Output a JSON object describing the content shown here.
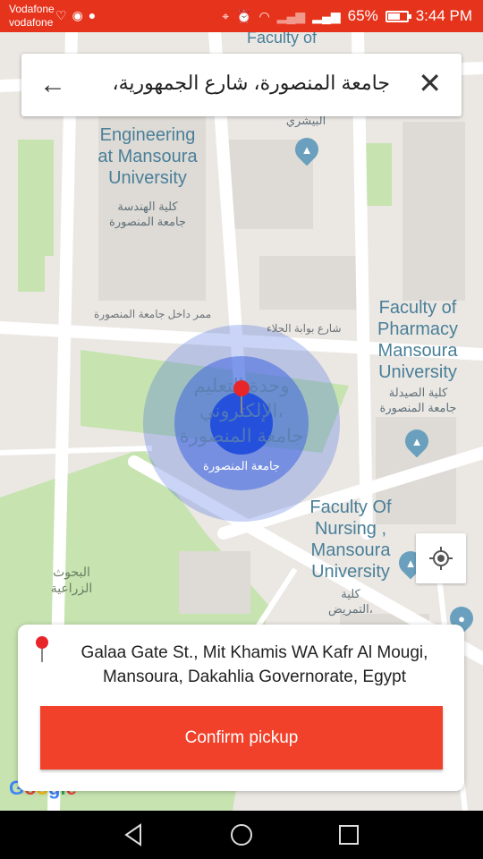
{
  "status_bar": {
    "carrier_1": "Vodafone",
    "carrier_2": "vodafone",
    "battery": "65%",
    "time": "3:44 PM",
    "battery_level": 0.65
  },
  "search": {
    "query": "جامعة المنصورة، شارع الجمهورية،",
    "back_icon": "arrow-left-icon",
    "clear_icon": "close-icon"
  },
  "map": {
    "labels": {
      "faculty_top": "Faculty of",
      "bishri_ar": "البيشري",
      "engineering_en": "Engineering\nat Mansoura\nUniversity",
      "engineering_ar": "كلية الهندسة\nجامعة المنصورة",
      "pharmacy_en": "Faculty of\nPharmacy\nMansoura\nUniversity",
      "pharmacy_ar": "كلية الصيدلة\nجامعة المنصورة",
      "nursing_en": "Faculty Of\nNursing ,\nMansoura\nUniversity",
      "nursing_ar": "كلية\nالتمريض،",
      "research_ar": "البحوث\nالزراعية",
      "road_inner": "ممر داخل جامعة المنصورة",
      "road_gate": "شارع بوابة الجلاء",
      "center_ar": "وحدة التعليم\nالإلكتروني،\nجامعة المنصورة",
      "center_small_ar": "جامعة المنصورة"
    }
  },
  "location_button": {
    "icon": "my-location-icon"
  },
  "pickup": {
    "address": "Galaa Gate St., Mit Khamis WA Kafr Al Mougi, Mansoura, Dakahlia Governorate, Egypt",
    "confirm_label": "Confirm pickup"
  },
  "google_logo": "Google",
  "colors": {
    "status_bar": "#e6331c",
    "confirm": "#f1412a",
    "map_green": "#c6e3b0",
    "map_land": "#ebe8e4",
    "accuracy_circle": "#3e64e0",
    "pin_red": "#e8262a"
  }
}
